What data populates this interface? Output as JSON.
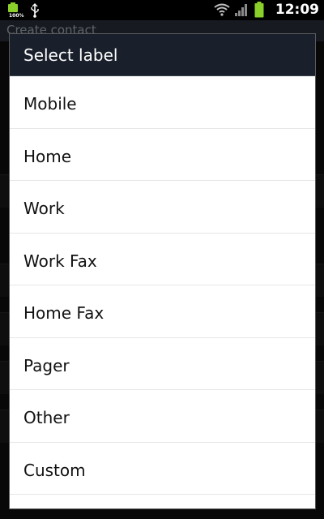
{
  "status_bar": {
    "battery_percent_text": "100%",
    "time": "12:09",
    "icons": [
      "battery-full-icon",
      "usb-icon",
      "wifi-icon",
      "signal-icon",
      "battery-icon"
    ]
  },
  "background": {
    "title": "Create contact"
  },
  "dialog": {
    "title": "Select label",
    "options": [
      "Mobile",
      "Home",
      "Work",
      "Work Fax",
      "Home Fax",
      "Pager",
      "Other",
      "Custom"
    ]
  },
  "colors": {
    "dialog_header": "#19202b",
    "battery_green": "#8bcf2b",
    "list_background": "#ffffff",
    "text_dark": "#111111"
  }
}
